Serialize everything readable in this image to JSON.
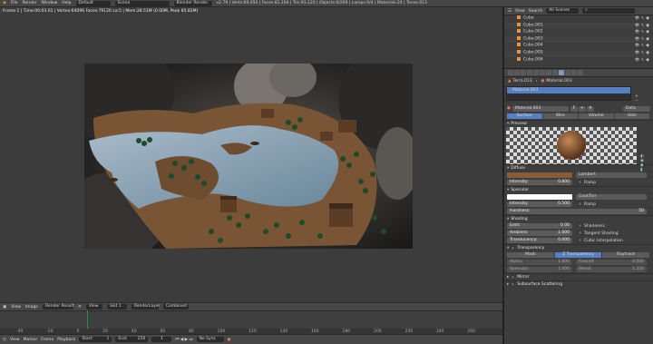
{
  "topbar": {
    "menus": [
      "File",
      "Render",
      "Window",
      "Help"
    ],
    "screen": "Default",
    "scene": "Scene",
    "engine": "Blender Render",
    "stats": "v2.79 | Verts:69,050 | Faces:81,104 | Tris:93,120 | Objects:0/269 | Lamps:0/4 | Materials:24 | Tense:013"
  },
  "render": {
    "title": "Frame:1 | Time:00:03.01 | Vertex:64096 Faces:79126 La:5 | Mem:28.51M (0.00M, Peak 85.82M)"
  },
  "image_header": {
    "items": [
      "View",
      "Image",
      "Render Result",
      "View",
      "Slot 1",
      "RenderLayer",
      "Combined"
    ]
  },
  "timeline": {
    "ticks": [
      "-40",
      "-20",
      "0",
      "20",
      "40",
      "60",
      "80",
      "100",
      "120",
      "140",
      "160",
      "180",
      "200",
      "220",
      "240",
      "260"
    ]
  },
  "bottombar": {
    "items": [
      "View",
      "Marker",
      "Frame",
      "Playback"
    ],
    "start": "Start:",
    "start_val": "1",
    "end": "End:",
    "end_val": "250",
    "current": "1",
    "sync": "No Sync"
  },
  "outliner": {
    "tabs": [
      "View",
      "Search",
      "All Scenes"
    ],
    "items": [
      "Cube",
      "Cube.001",
      "Cube.002",
      "Cube.003",
      "Cube.004",
      "Cube.005",
      "Cube.006"
    ]
  },
  "properties": {
    "breadcrumb_obj": "Terra.013",
    "breadcrumb_mat": "Material.003",
    "slot": "Material.003",
    "material_name": "Material.003",
    "material_users": "F",
    "data_mode": "Data",
    "tabs": [
      "Surface",
      "Wire",
      "Volume",
      "Halo"
    ],
    "preview_label": "Preview",
    "diffuse": {
      "label": "Diffuse",
      "shader": "Lambert",
      "intensity_label": "Intensity:",
      "intensity": "0.800",
      "ramp": "Ramp",
      "color": "#8a5b34"
    },
    "specular": {
      "label": "Specular",
      "shader": "CookTorr",
      "intensity_label": "Intensity:",
      "intensity": "0.500",
      "ramp": "Ramp",
      "hardness_label": "Hardness:",
      "hardness": "50",
      "color": "#ffffff"
    },
    "shading": {
      "label": "Shading",
      "emit_label": "Emit:",
      "emit": "0.00",
      "ambient_label": "Ambient:",
      "ambient": "1.000",
      "translucency_label": "Translucency:",
      "translucency": "0.000",
      "shadeless": "Shadeless",
      "tangent": "Tangent Shading",
      "cubic": "Cubic Interpolation"
    },
    "transparency": {
      "label": "Transparency",
      "modes": [
        "Mask",
        "Z Transparency",
        "Raytrace"
      ],
      "alpha_label": "Alpha:",
      "alpha": "1.000",
      "specular_label": "Specular:",
      "specular": "1.000",
      "fresnel_label": "Fresnel:",
      "fresnel": "0.000",
      "blend_label": "Blend:",
      "blend": "1.250"
    },
    "mirror": "Mirror",
    "sss": "Subsurface Scattering"
  }
}
